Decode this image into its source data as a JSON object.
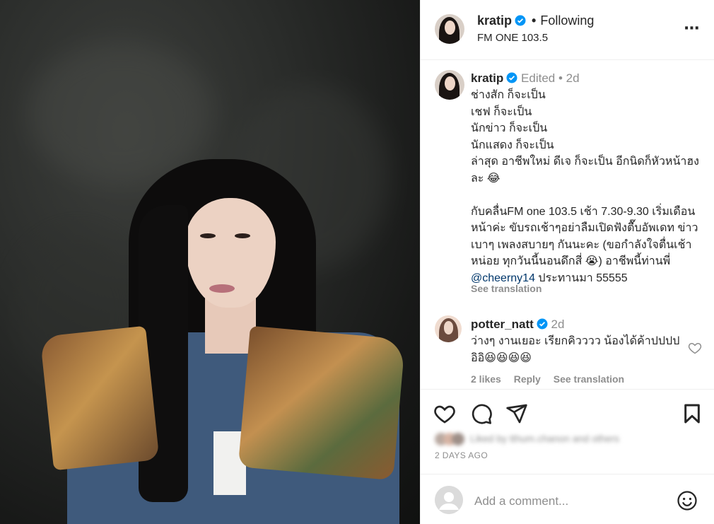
{
  "post": {
    "username": "kratip",
    "follow_status": "Following",
    "location": "FM ONE 103.5"
  },
  "caption": {
    "username": "kratip",
    "edited": "Edited",
    "time": "2d",
    "text": "ช่างสัก ก็จะเป็น\nเชฟ ก็จะเป็น\nนักข่าว ก็จะเป็น\nนักแสดง ก็จะเป็น\nล่าสุด อาชีพใหม่ ดีเจ ก็จะเป็น อีกนิดก็หัวหน้าฮงละ 😂\n\nกับคลื่นFM one 103.5 เช้า 7.30-9.30 เริ่มเดือนหน้าค่ะ ขับรถเช้าๆอย่าลืมเปิดฟังตื๊บอัพเดท ข่าวเบาๆ เพลงสบายๆ กันนะคะ (ขอกำลังใจตื่นเช้า หน่อย ทุกวันนี้นอนดึกสี่ 😭) อาชีพนี้ท่านพี่ ",
    "mention": "@cheerny14",
    "text_after": " ประทานมา 55555",
    "see_translation": "See translation"
  },
  "comment": {
    "username": "potter_natt",
    "time": "2d",
    "text": "ว่างๆ งานเยอะ เรียกคิวววว น้องได้ค้าปปปป\nอิอิ😆😆😆😆",
    "likes": "2 likes",
    "reply": "Reply",
    "see_translation": "See translation"
  },
  "actions": {
    "liked_by": "Liked by tthum.chanon and others",
    "date": "2 DAYS AGO"
  },
  "add_comment": {
    "placeholder": "Add a comment..."
  },
  "icons": {
    "more": "more-options-icon",
    "like": "heart-icon",
    "comment": "comment-icon",
    "share": "share-icon",
    "save": "bookmark-icon",
    "verified": "verified-badge-icon",
    "emoji": "emoji-icon"
  },
  "colors": {
    "verified": "#0095f6",
    "muted": "#8e8e8e",
    "link": "#00376b"
  }
}
